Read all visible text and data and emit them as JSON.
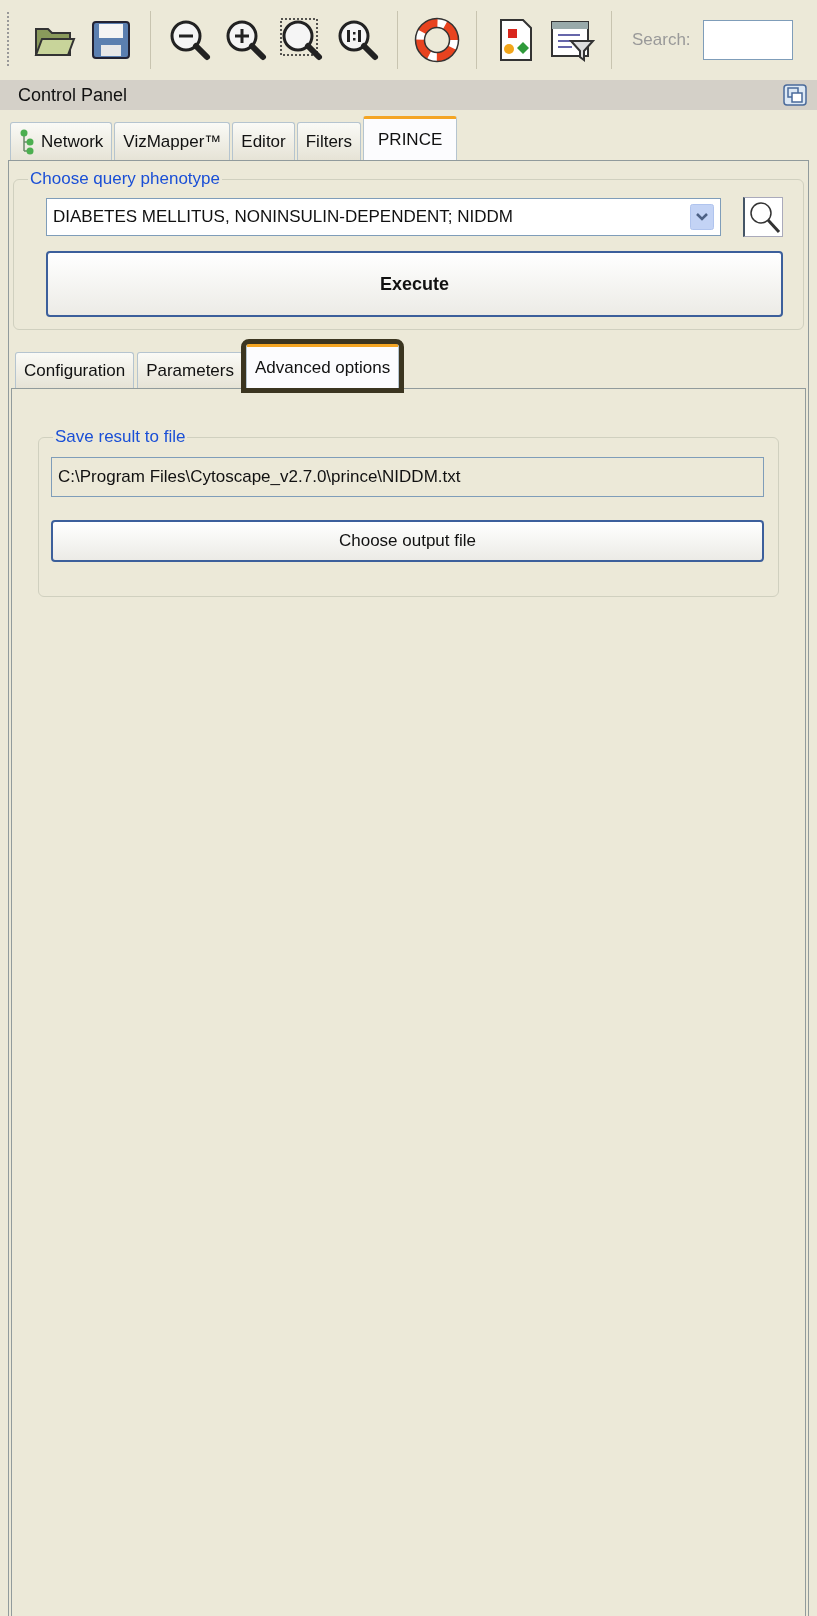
{
  "toolbar": {
    "items": [
      {
        "kind": "folder"
      },
      {
        "kind": "save"
      },
      {
        "kind": "zoom-out"
      },
      {
        "kind": "zoom-in"
      },
      {
        "kind": "zoom-selection"
      },
      {
        "kind": "zoom-actual"
      },
      {
        "kind": "help"
      },
      {
        "kind": "layout"
      },
      {
        "kind": "filter"
      }
    ],
    "search": {
      "label": "Search:"
    }
  },
  "panel": {
    "title": "Control Panel"
  },
  "tabs": [
    {
      "label": "Network",
      "selected": false,
      "kind": "tree"
    },
    {
      "label": "VizMapper™",
      "selected": false
    },
    {
      "label": "Editor",
      "selected": false
    },
    {
      "label": "Filters",
      "selected": false
    },
    {
      "label": "PRINCE",
      "selected": true
    }
  ],
  "query": {
    "legend": "Choose query phenotype",
    "value": "DIABETES MELLITUS, NONINSULIN-DEPENDENT; NIDDM",
    "button": "Execute"
  },
  "subtabs": [
    {
      "label": "Configuration",
      "selected": false,
      "highlighted": false
    },
    {
      "label": "Parameters",
      "selected": false,
      "highlighted": false
    },
    {
      "label": "Advanced options",
      "selected": true,
      "highlighted": true
    }
  ],
  "save": {
    "legend": "Save result to file",
    "path": "C:\\Program Files\\Cytoscape_v2.7.0\\prince\\NIDDM.txt",
    "button": "Choose output file"
  }
}
